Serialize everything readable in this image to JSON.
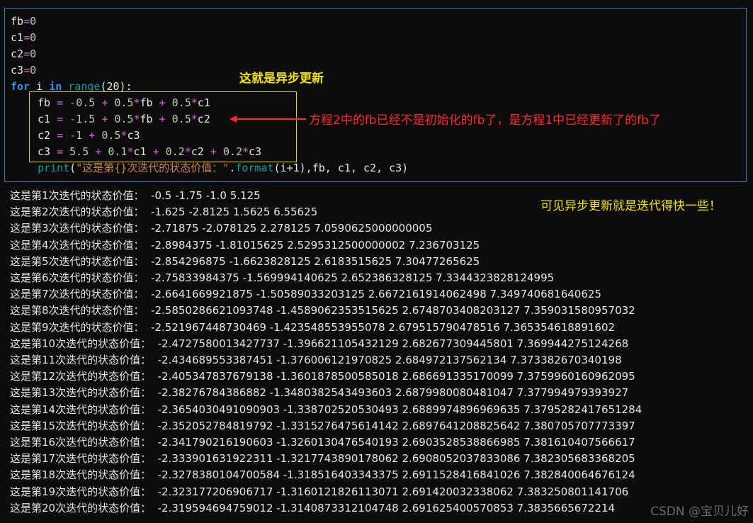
{
  "code": {
    "l1": {
      "a": "fb",
      "op": "=",
      "v": "0"
    },
    "l2": {
      "a": "c1",
      "op": "=",
      "v": "0"
    },
    "l3": {
      "a": "c2",
      "op": "=",
      "v": "0"
    },
    "l4": {
      "a": "c3",
      "op": "=",
      "v": "0"
    },
    "l5": {
      "for": "for",
      "var": " i ",
      "in": "in",
      "sp": " ",
      "range": "range",
      "arg": "(20):"
    },
    "l6": "fb = -0.5 + 0.5*fb + 0.5*c1",
    "l7": "c1 = -1.5 + 0.5*fb + 0.5*c2",
    "l8": "c2 = -1 + 0.5*c3",
    "l9": "c3 = 5.5 + 0.1*c1 + 0.2*c2 + 0.2*c3",
    "l10": {
      "print": "print",
      "open": "(",
      "str": "\"这是第{}次迭代的状态价值：\"",
      "dot": ".",
      "format": "format",
      "rest": "(i+1),fb, c1, c2, c3)"
    }
  },
  "annotations": {
    "async_title": "这就是异步更新",
    "equation_note": "方程2中的fb已经不是初始化的fb了，是方程1中已经更新了的fb了",
    "conclusion": "可见异步更新就是迭代得快一些！"
  },
  "output": [
    "这是第1次迭代的状态价值：  -0.5 -1.75 -1.0 5.125",
    "这是第2次迭代的状态价值：  -1.625 -2.8125 1.5625 6.55625",
    "这是第3次迭代的状态价值：  -2.71875 -2.078125 2.278125 7.0590625000000005",
    "这是第4次迭代的状态价值：  -2.8984375 -1.81015625 2.5295312500000002 7.236703125",
    "这是第5次迭代的状态价值：  -2.854296875 -1.6623828125 2.6183515625 7.30477265625",
    "这是第6次迭代的状态价值：  -2.75833984375 -1.569994140625 2.652386328125 7.3344323828124995",
    "这是第7次迭代的状态价值：  -2.6641669921875 -1.50589033203125 2.6672161914062498 7.349740681640625",
    "这是第8次迭代的状态价值：  -2.5850286621093748 -1.4589062353515625 2.6748703408203127 7.359031580957032",
    "这是第9次迭代的状态价值：  -2.521967448730469 -1.423548553955078 2.679515790478516 7.365354618891602",
    "这是第10次迭代的状态价值：  -2.4727580013427737 -1.396621105432129 2.682677309445801 7.369944275124268",
    "这是第11次迭代的状态价值：  -2.434689553387451 -1.376006121970825 2.684972137562134 7.373382670340198",
    "这是第12次迭代的状态价值：  -2.405347837679138 -1.3601878500585018 2.686691335170099 7.3759960160962095",
    "这是第13次迭代的状态价值：  -2.38276784386882 -1.3480382543493603 2.6879980080481047 7.377994979393927",
    "这是第14次迭代的状态价值：  -2.3654030491090903 -1.338702520530493 2.6889974896969635 7.3795282417651284",
    "这是第15次迭代的状态价值：  -2.352052784819792 -1.3315276475614142 2.6897641208825642 7.380705707773397",
    "这是第16次迭代的状态价值：  -2.341790216190603 -1.3260130476540193 2.6903528538866985 7.381610407566617",
    "这是第17次迭代的状态价值：  -2.333901631922311 -1.3217743890178062 2.6908052037833086 7.382305683368205",
    "这是第18次迭代的状态价值：  -2.3278380104700584 -1.318516403343375 2.6911528416841026 7.382840064676124",
    "这是第19次迭代的状态价值：  -2.323177206906717 -1.3160121826113071 2.691420032338062 7.383250801141706",
    "这是第20次迭代的状态价值：  -2.319594694759012 -1.3140873312104748 2.691625400570853 7.3835665672214"
  ],
  "watermark": "CSDN @宝贝儿好",
  "colors": {
    "keyword": "#3b8eea",
    "operator": "#d16ad6",
    "number": "#b5cea8",
    "string": "#c98256",
    "annotation_yellow": "#f5e400",
    "annotation_red": "#ff2a2a"
  }
}
